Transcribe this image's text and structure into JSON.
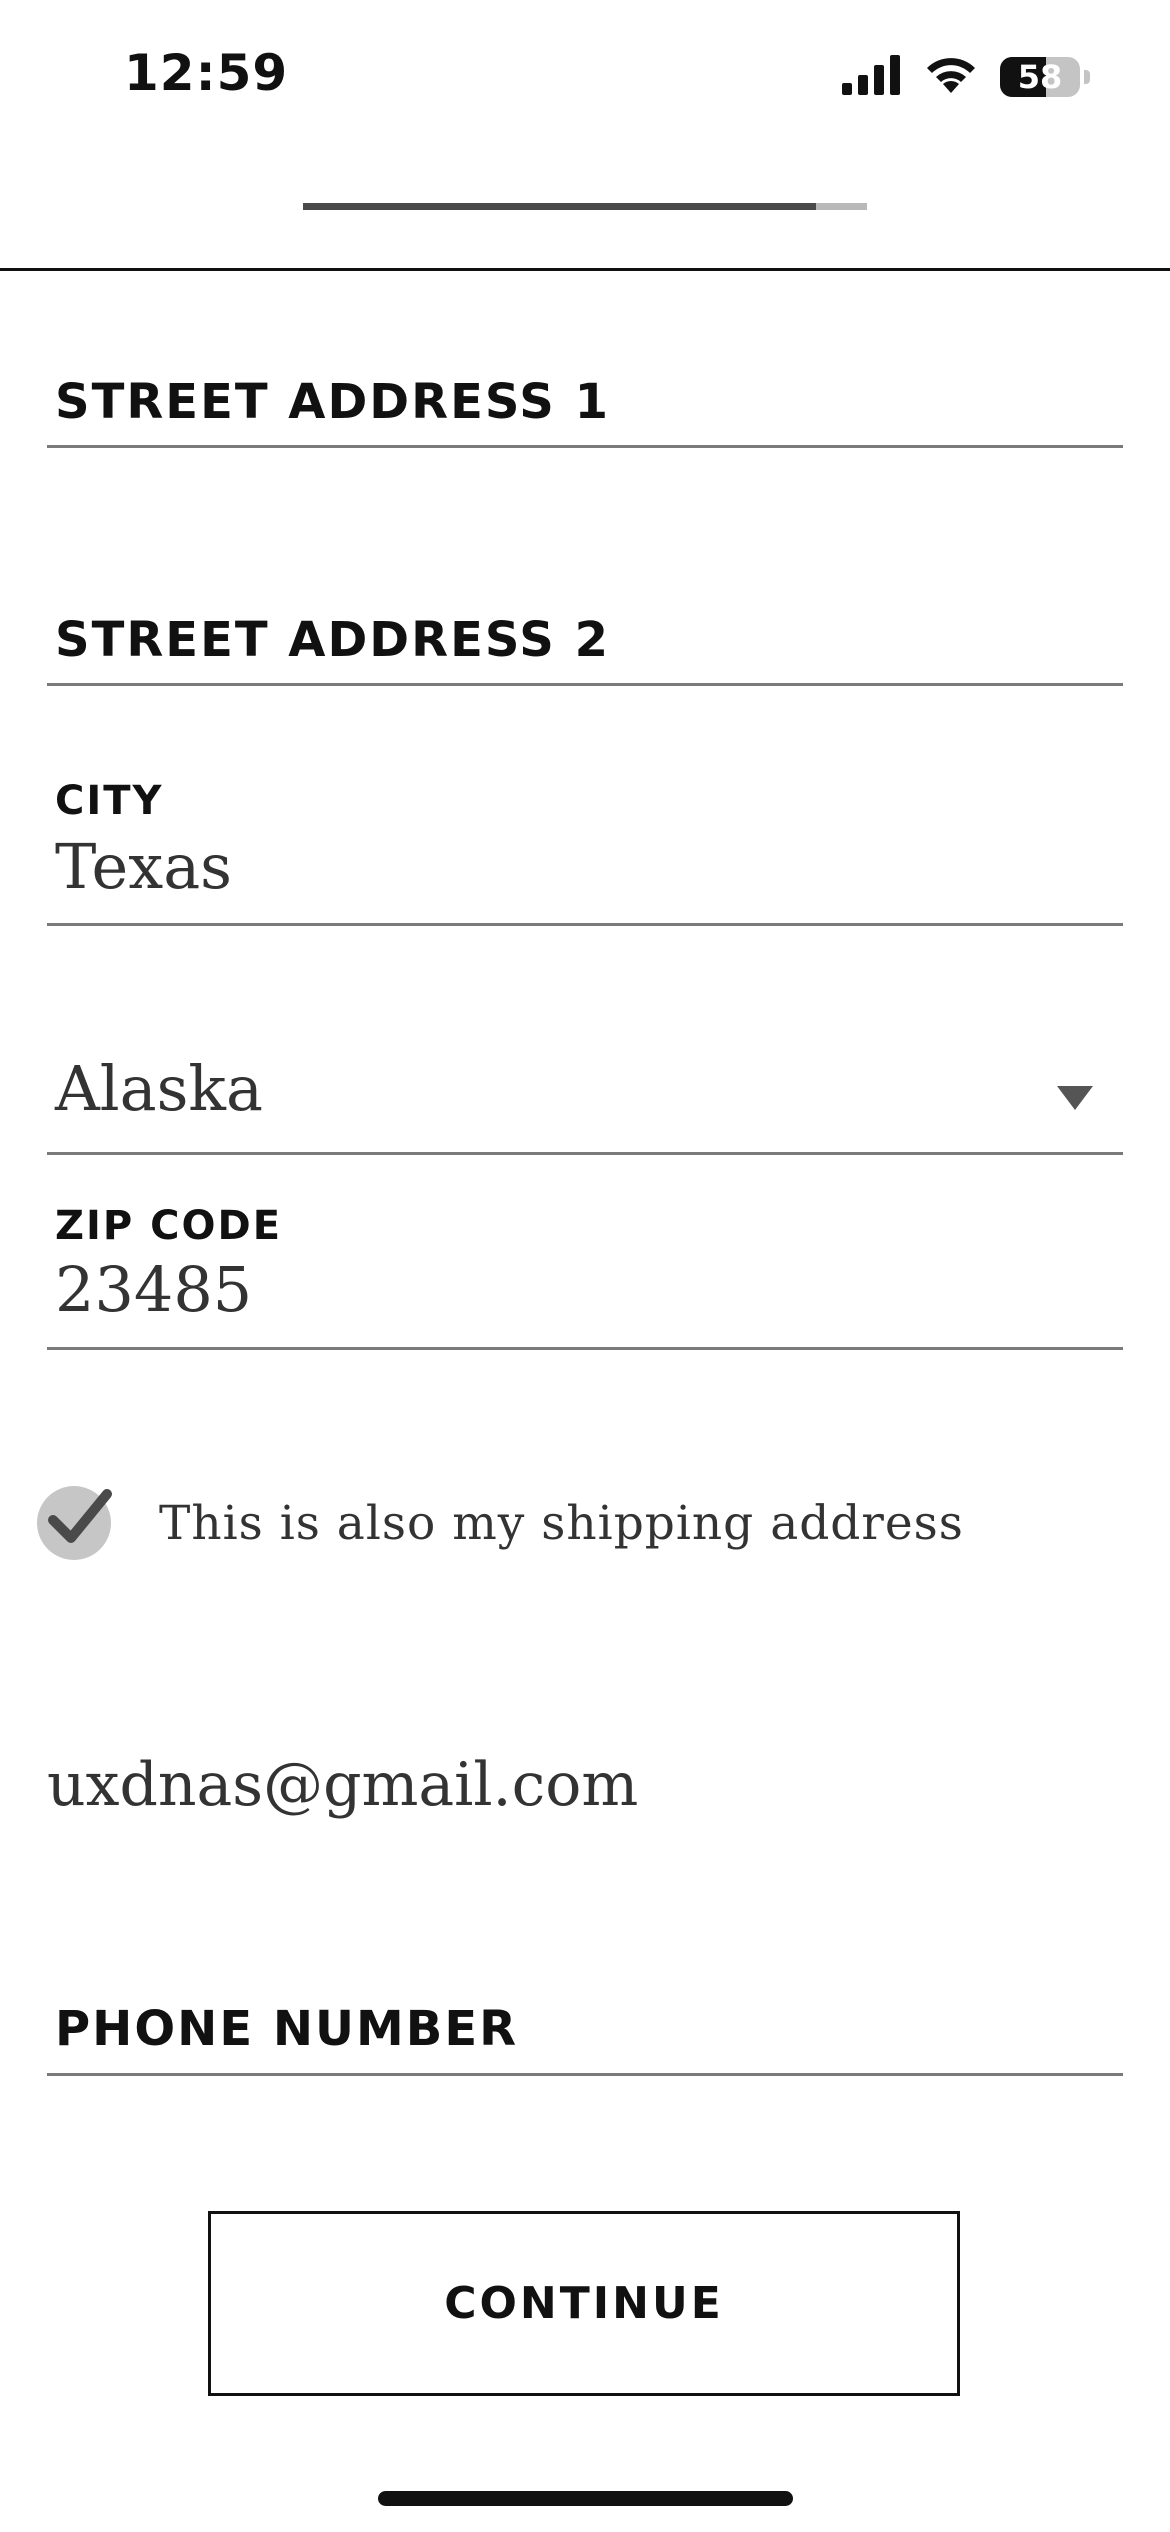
{
  "status_bar": {
    "time": "12:59",
    "battery_percent": "58",
    "battery_level": 0.58,
    "icons": [
      "cellular-signal-icon",
      "wifi-icon",
      "battery-icon"
    ]
  },
  "progress": {
    "value": 0.91
  },
  "form": {
    "street1": {
      "label": "STREET ADDRESS 1",
      "value": ""
    },
    "street2": {
      "label": "STREET ADDRESS 2",
      "value": ""
    },
    "city": {
      "label": "CITY",
      "value": "Texas"
    },
    "state": {
      "value": "Alaska",
      "icon": "chevron-down-icon"
    },
    "zip": {
      "label": "ZIP CODE",
      "value": "23485"
    },
    "shipping_checkbox": {
      "label": "This is also my shipping address",
      "checked": true
    },
    "email": {
      "value": "uxdnas@gmail.com"
    },
    "phone": {
      "label": "PHONE NUMBER",
      "value": ""
    }
  },
  "actions": {
    "continue_label": "CONTINUE"
  },
  "colors": {
    "text": "#111111",
    "underline": "#7a7a7a",
    "progress_fill": "#4a4a4a",
    "progress_track": "#b9b9b9",
    "checkbox_bg": "#c6c6c6"
  }
}
